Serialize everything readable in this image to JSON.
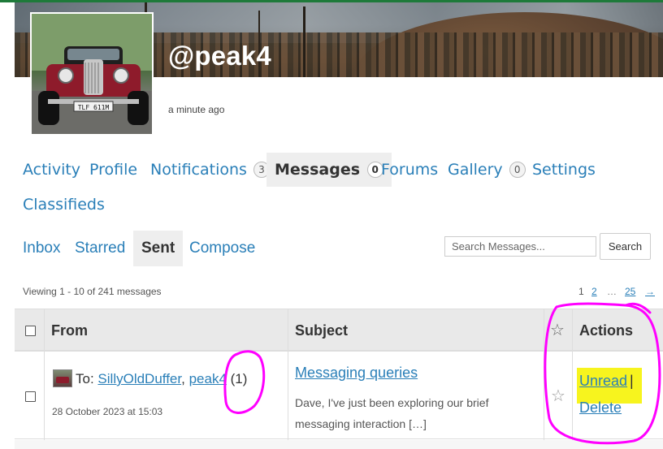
{
  "profile": {
    "username": "@peak4",
    "last_active": "a minute ago",
    "avatar_plate": "TLF 611M"
  },
  "nav": {
    "items": [
      {
        "label": "Activity",
        "count": ""
      },
      {
        "label": "Profile",
        "count": ""
      },
      {
        "label": "Notifications",
        "count": "3"
      },
      {
        "label": "Messages",
        "count": "0"
      },
      {
        "label": "Forums",
        "count": ""
      },
      {
        "label": "Gallery",
        "count": "0"
      },
      {
        "label": "Settings",
        "count": ""
      },
      {
        "label": "Classifieds",
        "count": ""
      }
    ],
    "active": "Messages"
  },
  "subnav": {
    "items": [
      "Inbox",
      "Starred",
      "Sent",
      "Compose"
    ],
    "active": "Sent"
  },
  "search": {
    "placeholder": "Search Messages...",
    "button_label": "Search"
  },
  "listing": {
    "viewing_text": "Viewing 1 - 10 of 241 messages",
    "pagination": [
      "1",
      "2",
      "…",
      "25",
      "→"
    ],
    "current_page": "1"
  },
  "table": {
    "headers": {
      "from": "From",
      "subject": "Subject",
      "actions": "Actions"
    },
    "rows": [
      {
        "to_prefix": "To:",
        "recipients": [
          "SillyOldDuffer",
          "peak4"
        ],
        "separator": ",",
        "count": "(1)",
        "date": "28 October 2023 at 15:03",
        "subject": "Messaging queries",
        "excerpt": "Dave, I've just been exploring our brief messaging interaction […]",
        "actions": [
          "Unread",
          "Delete"
        ],
        "action_separator": "|"
      }
    ]
  },
  "colors": {
    "link": "#2a7fb8",
    "active_tab_bg": "#eeeeee",
    "highlight": "#f7f41e",
    "annotation": "#ff00ff",
    "top_bar": "#1e7a3a"
  },
  "icons": {
    "star": "star-outline-icon",
    "checkbox": "checkbox-icon"
  }
}
